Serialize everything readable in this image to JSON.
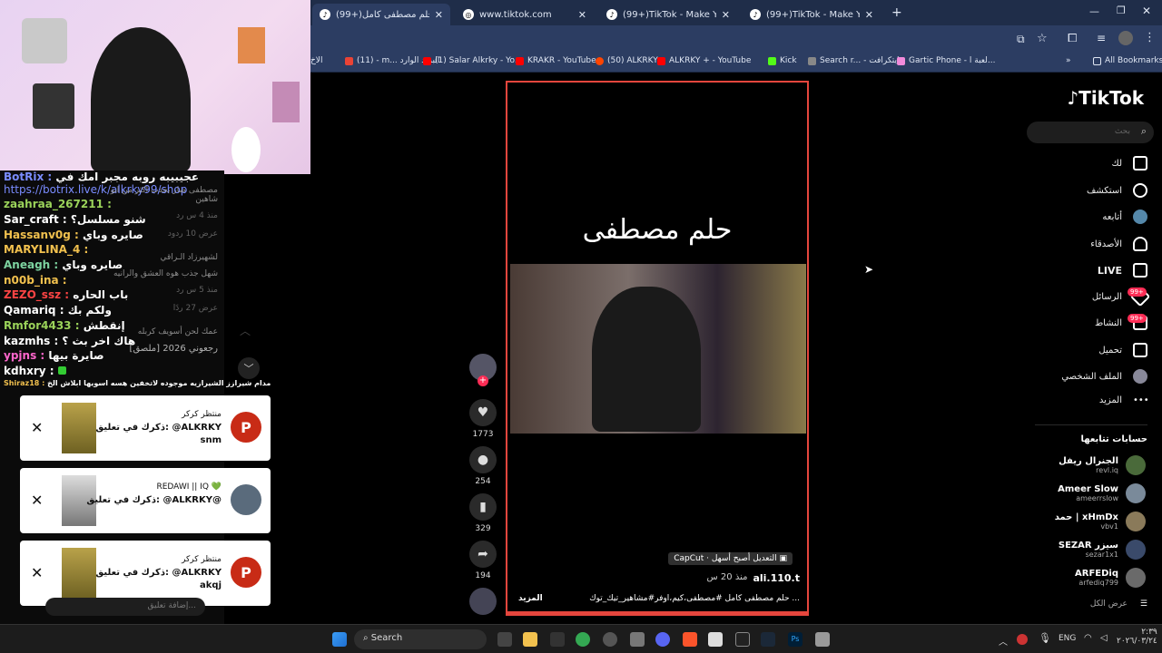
{
  "browser": {
    "tabs": [
      {
        "label": "(99+)حلم مصطفى كامل #...",
        "active": true
      },
      {
        "label": "www.tiktok.com",
        "active": false
      },
      {
        "label": "(99+)TikTok - Make Your Day",
        "active": false
      },
      {
        "label": "(99+)TikTok - Make Your Day",
        "active": false
      }
    ],
    "bookmarks": [
      "الاخ",
      "(11) - m... البريد الوارد",
      "(1) Salar Alkrky - Yo...",
      "KRAKR - YouTube",
      "(50) ALKRKY",
      "ALKRKY + - YouTube",
      "Kick",
      "Search r... - مايتكرافت",
      "Gartic Phone - لعبة ا...",
      "All Bookmarks"
    ]
  },
  "chat": {
    "lines": [
      {
        "user": "BotRix",
        "msg": "عجيبيبه روبه مجبر امك في",
        "color": "#7a8cff"
      },
      {
        "user": "https://botrix.live/k/alkrky99/shop",
        "msg": "",
        "color": "#7a8cff"
      },
      {
        "user": "zaahraa_267211",
        "msg": "",
        "color": "#9bd35a"
      },
      {
        "user": "Sar_craft",
        "msg": "شنو مسلسل؟",
        "color": "#ffffff"
      },
      {
        "user": "Hassanv0g",
        "msg": "صايره وباي",
        "color": "#f2c14e"
      },
      {
        "user": "MARYLINA_4",
        "msg": "",
        "color": "#f2c14e"
      },
      {
        "user": "Aneagh",
        "msg": "صايره وباي",
        "color": "#7dd3a0"
      },
      {
        "user": "n00b_ina",
        "msg": "",
        "color": "#f2c14e"
      },
      {
        "user": "ZEZO_ssz",
        "msg": "باب الحاره",
        "color": "#ff4444"
      },
      {
        "user": "Qamariq",
        "msg": "ولكم بك",
        "color": "#ffffff"
      },
      {
        "user": "Rmfor4433",
        "msg": "إنقطش",
        "color": "#9bd35a"
      },
      {
        "user": "kazmhs",
        "msg": "هاك اخر بث ؟",
        "color": "#ffffff"
      },
      {
        "user": "ypjns",
        "msg": "صايرة بيها",
        "color": "#ff66cc"
      },
      {
        "user": "kdhxry",
        "msg": "",
        "color": "#ffffff"
      },
      {
        "user": "Shiraz18",
        "msg": "مدام شيرازز الشيرازيه موجوده لاتخفين هسه اسويها ابلاش الخ",
        "color": "#f2c14e"
      }
    ],
    "side": [
      "مصطفى صار يجذب اكثر من ابو شاهين",
      "منذ 4 س   رد",
      "عرض 10 ردود",
      "لشهيرزاد الـراقي",
      "شهل جذب هوه العشق والرانيه",
      "منذ 5 س   رد",
      "عرض 27 ردًا",
      "عمك لحن أسويف كربله",
      "[ملصق] رجعوني 2026"
    ]
  },
  "notifications": [
    {
      "title": "منتظر كركر",
      "line1": "ذكرك في تعليق: @ALKRKY",
      "line2": "snm",
      "avatar": "P"
    },
    {
      "title": "REDAWI || IQ 💚",
      "line1": "ذكرك في تعليق: @ALKRKY@",
      "line2": "",
      "avatar": ""
    },
    {
      "title": "منتظر كركر",
      "line1": "ذكرك في تعليق: @ALKRKY",
      "line2": "akqj",
      "avatar": "P"
    }
  ],
  "chat_input": {
    "placeholder": "إضافة تعليق..."
  },
  "tiktok": {
    "logo": "TikTok",
    "search_placeholder": "بحث",
    "nav": [
      "لك",
      "استكشف",
      "أتابعه",
      "الأصدقاء",
      "LIVE",
      "الرسائل",
      "النشاط",
      "تحميل",
      "الملف الشخصي",
      "المزيد"
    ],
    "badges": {
      "messages": "99+",
      "activity": "99+"
    },
    "following_header": "حسابات تتابعها",
    "following": [
      {
        "name": "الجنرال ريفل",
        "handle": "revl.iq"
      },
      {
        "name": "Ameer Slow",
        "handle": "ameerrslow"
      },
      {
        "name": "حمد | xHmDx",
        "handle": "vbv1"
      },
      {
        "name": "SEZAR سيزر",
        "handle": "sezar1x1"
      },
      {
        "name": "ARFEDiq",
        "handle": "arfediq799"
      }
    ],
    "see_all": "عرض الكل",
    "video": {
      "title_text": "حلم مصطفى",
      "capcut": "CapCut · التعديل أصبح أسهل",
      "author": "ali.110.t",
      "age": "منذ 20 س",
      "caption": "حلم مصطفى كامل #مصطفى،كيم،اوفر#مشاهير_تيك_توك ...",
      "more": "المزيد"
    },
    "actions": {
      "likes": "1773",
      "comments": "254",
      "saves": "329",
      "shares": "194"
    }
  },
  "taskbar": {
    "search": "Search",
    "lang": "ENG",
    "time": "٢:٣٩",
    "date": "٢٠٢٦/٠٣/٢٤"
  }
}
